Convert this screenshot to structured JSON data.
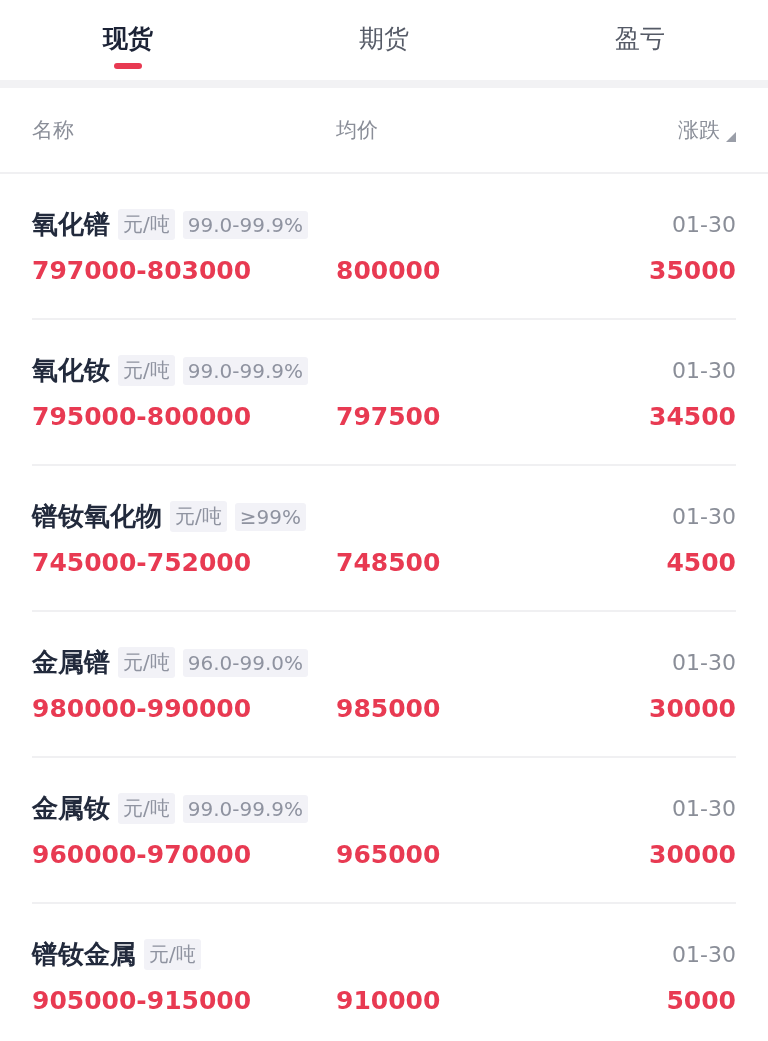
{
  "tabs": [
    {
      "label": "现货",
      "selected": true
    },
    {
      "label": "期货",
      "selected": false
    },
    {
      "label": "盈亏",
      "selected": false
    }
  ],
  "table": {
    "columns": [
      "名称",
      "均价",
      "涨跌"
    ],
    "rows": [
      {
        "name": "氧化镨",
        "unit": "元/吨",
        "purity": "99.0-99.9%",
        "date": "01-30",
        "range": "797000-803000",
        "average": "800000",
        "change": "35000"
      },
      {
        "name": "氧化钕",
        "unit": "元/吨",
        "purity": "99.0-99.9%",
        "date": "01-30",
        "range": "795000-800000",
        "average": "797500",
        "change": "34500"
      },
      {
        "name": "镨钕氧化物",
        "unit": "元/吨",
        "purity": "≥99%",
        "date": "01-30",
        "range": "745000-752000",
        "average": "748500",
        "change": "4500"
      },
      {
        "name": "金属镨",
        "unit": "元/吨",
        "purity": "96.0-99.0%",
        "date": "01-30",
        "range": "980000-990000",
        "average": "985000",
        "change": "30000"
      },
      {
        "name": "金属钕",
        "unit": "元/吨",
        "purity": "99.0-99.9%",
        "date": "01-30",
        "range": "960000-970000",
        "average": "965000",
        "change": "30000"
      },
      {
        "name": "镨钕金属",
        "unit": "元/吨",
        "date": "01-30",
        "range": "905000-915000",
        "average": "910000",
        "change": "5000"
      }
    ]
  }
}
